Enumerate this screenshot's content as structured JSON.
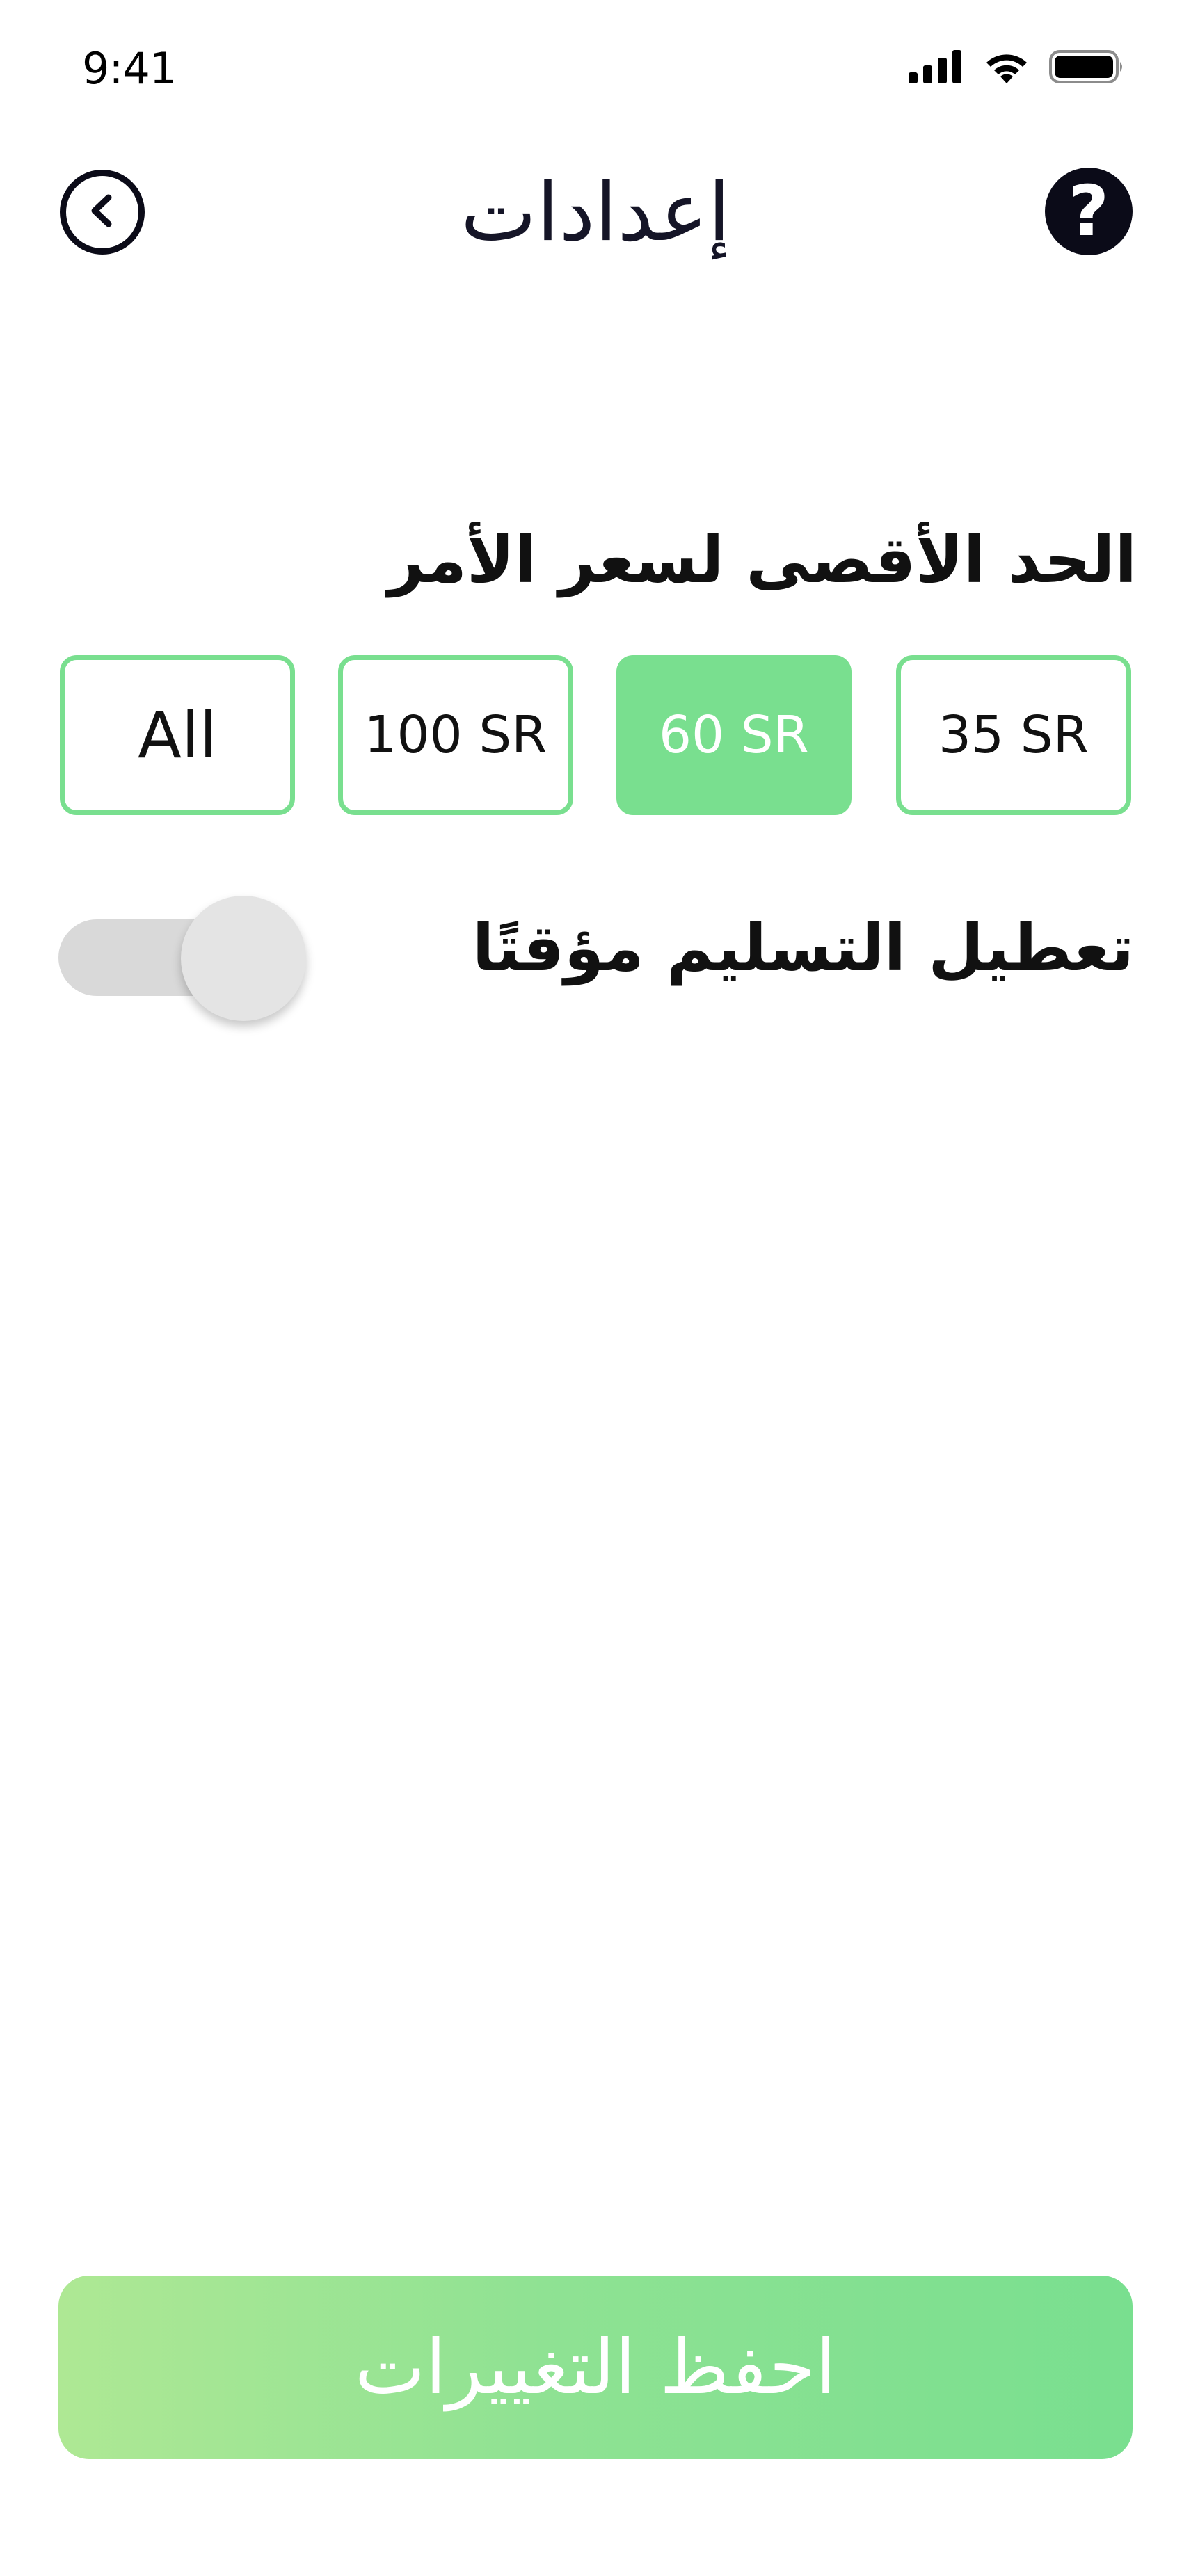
{
  "status_bar": {
    "time": "9:41",
    "icons": [
      "signal-icon",
      "wifi-icon",
      "battery-icon"
    ]
  },
  "header": {
    "title": "إعدادات",
    "back_icon": "chevron-left-circle-icon",
    "help_icon": "question-circle-icon",
    "help_glyph": "?"
  },
  "max_order_price": {
    "label": "الحد الأقصى لسعر الأمر",
    "options": [
      "All",
      "100 SR",
      "60 SR",
      "35 SR"
    ],
    "selected": "60 SR"
  },
  "pause_delivery": {
    "label": "تعطيل التسليم مؤقتًا",
    "enabled": false
  },
  "save_button": {
    "label": "احفظ التغييرات"
  },
  "colors": {
    "accent": "#79df8f",
    "accent_light": "#aee894",
    "text": "#111111",
    "title": "#151527",
    "toggle_track": "#d9d9d9",
    "toggle_knob": "#e4e4e4"
  }
}
